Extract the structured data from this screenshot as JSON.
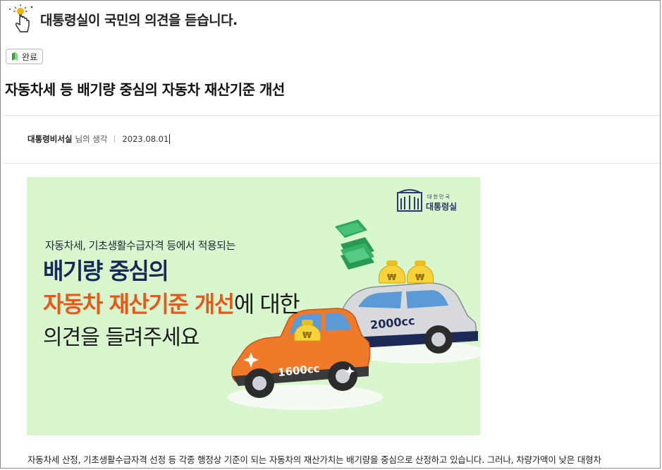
{
  "site": {
    "title": "대통령실이 국민의 의견을 듣습니다."
  },
  "status_badge": {
    "label": "완료",
    "color": "#3aa33a"
  },
  "post": {
    "title": "자동차세 등 배기량 중심의 자동차 재산기준 개선",
    "author": "대통령비서실",
    "author_suffix": "님의 생각",
    "date": "2023.08.01"
  },
  "banner": {
    "subtitle": "자동차세, 기초생활수급자격 등에서 적용되는",
    "line1": "배기량 중심의",
    "line2_highlight": "자동차 재산기준 개선",
    "line2_rest": "에 대한",
    "line3": "의견을 들려주세요",
    "brand_small": "대한민국",
    "brand_name": "대통령실",
    "car_big_label": "2000cc",
    "car_small_label": "1600cc",
    "colors": {
      "background": "#d9f7cf",
      "navy": "#172a55",
      "orange": "#e8581b"
    }
  },
  "body": {
    "paragraph": "자동차세 산정, 기초생활수급자격 선정 등 각종 행정상 기준이 되는 자동차의 재산가치는 배기량을 중심으로 산정하고 있습니다. 그러나, 차량가액이 낮은 대형차"
  }
}
